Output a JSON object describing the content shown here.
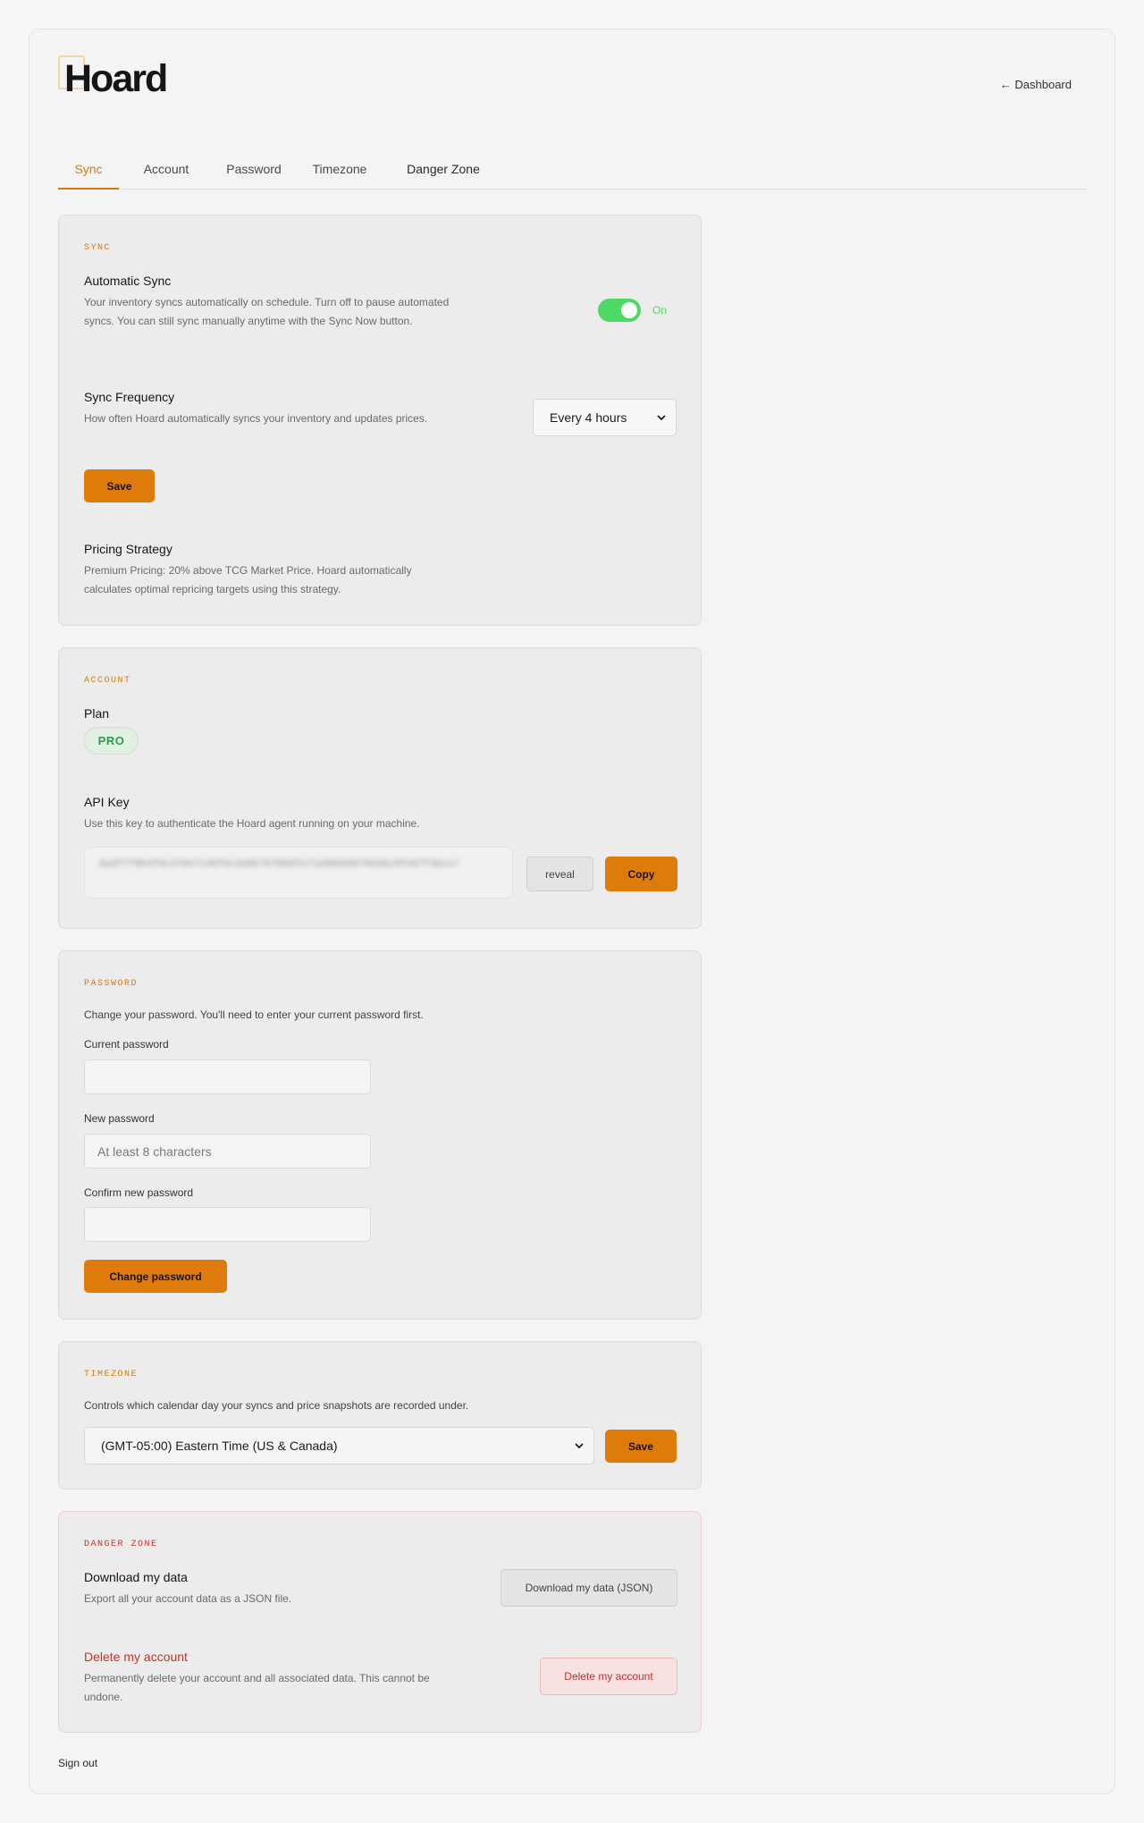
{
  "brand": {
    "logo_text": "Hoard"
  },
  "header": {
    "dashboard_link": "← Dashboard"
  },
  "tabs": [
    {
      "label": "Sync"
    },
    {
      "label": "Account"
    },
    {
      "label": "Password"
    },
    {
      "label": "Timezone"
    },
    {
      "label": "Danger Zone"
    }
  ],
  "sync": {
    "section": "SYNC",
    "auto_title": "Automatic Sync",
    "auto_desc": "Your inventory syncs automatically on schedule. Turn off to pause automated syncs. You can still sync manually anytime with the Sync Now button.",
    "toggle_state": "On",
    "freq_title": "Sync Frequency",
    "freq_desc": "How often Hoard automatically syncs your inventory and updates prices.",
    "freq_value": "Every 4 hours",
    "save_label": "Save",
    "pricing_title": "Pricing Strategy",
    "pricing_desc": "Premium Pricing: 20% above TCG Market Price. Hoard automatically calculates optimal repricing targets using this strategy."
  },
  "account": {
    "section": "ACCOUNT",
    "plan_title": "Plan",
    "plan_badge": "PRO",
    "apikey_title": "API Key",
    "apikey_desc": "Use this key to authenticate the Hoard agent running on your machine.",
    "apikey_value": "6a6f7f9b4f0c37047146f6c3a8b7078b6fa71a98666076d3bc8fe97f36ce7",
    "reveal_label": "reveal",
    "copy_label": "Copy"
  },
  "password": {
    "section": "PASSWORD",
    "desc": "Change your password. You'll need to enter your current password first.",
    "current_label": "Current password",
    "new_label": "New password",
    "new_placeholder": "At least 8 characters",
    "confirm_label": "Confirm new password",
    "submit_label": "Change password"
  },
  "timezone": {
    "section": "TIMEZONE",
    "desc": "Controls which calendar day your syncs and price snapshots are recorded under.",
    "value": "(GMT-05:00) Eastern Time (US & Canada)",
    "save_label": "Save"
  },
  "danger": {
    "section": "DANGER ZONE",
    "download_title": "Download my data",
    "download_desc": "Export all your account data as a JSON file.",
    "download_button": "Download my data (JSON)",
    "delete_title": "Delete my account",
    "delete_desc": "Permanently delete your account and all associated data. This cannot be undone.",
    "delete_button": "Delete my account"
  },
  "footer": {
    "signout": "Sign out"
  },
  "colors": {
    "accent": "#de7b0b",
    "success": "#4cd964",
    "danger": "#c9302c"
  }
}
